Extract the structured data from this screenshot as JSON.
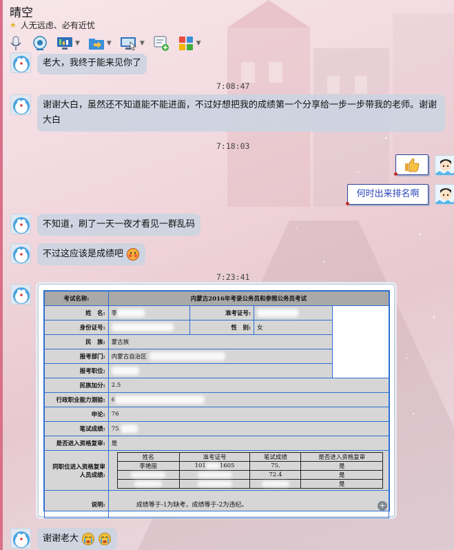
{
  "header": {
    "title": "晴空",
    "signature": "人无远虑、必有近忧"
  },
  "toolbar": {
    "items": [
      "microphone-icon",
      "video-icon",
      "screen-share-icon",
      "file-transfer-icon",
      "remote-desktop-icon",
      "add-app-icon",
      "apps-grid-icon"
    ]
  },
  "messages": {
    "m1": "老大，我终于能来见你了",
    "t1": "7:08:47",
    "m2": "谢谢大白，虽然还不知道能不能进面，不过好想把我的成绩第一个分享给一步一步带我的老师。谢谢大白",
    "t2": "7:18:03",
    "r2": "何时出来排名啊",
    "m3": "不知道，刷了一天一夜才看见一群乱码",
    "m4": "不过这应该是成绩吧",
    "t3": "7:23:41",
    "m5": "谢谢老大"
  },
  "score_sheet": {
    "exam_label": "考试名称:",
    "exam_name": "内蒙古2016年考录公务员和参照公务员考试",
    "name_label": "姓　名:",
    "name_value": "李",
    "ticket_label": "准考证号:",
    "id_label": "身份证号:",
    "gender_label": "性　别:",
    "gender_value": "女",
    "ethnic_label": "民　族:",
    "ethnic_value": "蒙古族",
    "dept_label": "报考部门:",
    "dept_value": "内蒙古自治区",
    "position_label": "报考职位:",
    "bonus_label": "民族加分:",
    "bonus_value": "2.5",
    "xingce_label": "行政职业能力测验:",
    "xingce_value": "6",
    "shenlun_label": "申论:",
    "shenlun_value": "76",
    "written_label": "笔试成绩:",
    "written_value": "75.",
    "review_label": "是否进入资格复审:",
    "review_value": "是",
    "peers_label": "同职位进入资格复审人员成绩:",
    "peers_headers": [
      "姓名",
      "准考证号",
      "笔试成绩",
      "是否进入资格复审"
    ],
    "peers_rows": [
      [
        "李艳丽",
        "101",
        "1605",
        "75.",
        "是"
      ],
      [
        "",
        "",
        "",
        "72.4",
        "是"
      ],
      [
        "",
        "",
        "",
        "",
        "是"
      ]
    ],
    "note_label": "说明:",
    "note_value": "成绩等于-1为缺考，成绩等于-2为违纪。"
  },
  "colors": {
    "bubble_left": "#cbd4e1",
    "bubble_right_border": "#2a3f9a",
    "bubble_right_text": "#2b44b8",
    "sheet_border": "#2d6fd0"
  }
}
